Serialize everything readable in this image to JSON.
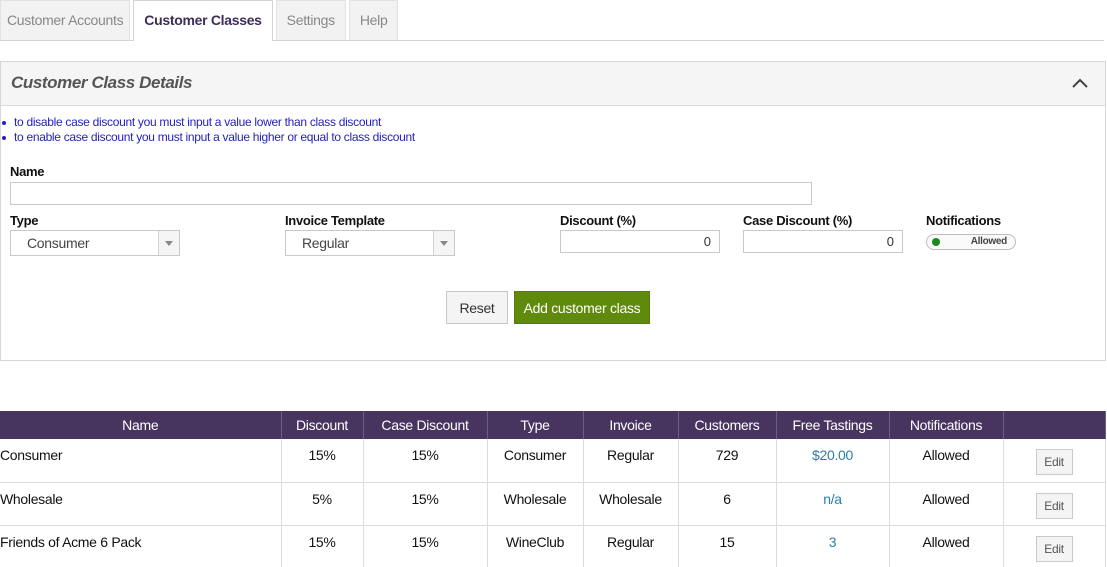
{
  "tabs": [
    {
      "label": "Customer Accounts",
      "active": false
    },
    {
      "label": "Customer Classes",
      "active": true
    },
    {
      "label": "Settings",
      "active": false
    },
    {
      "label": "Help",
      "active": false
    }
  ],
  "panel": {
    "title": "Customer Class Details",
    "collapse_icon": "chevron-up-icon",
    "notes": [
      "to disable case discount you must input a value lower than class discount",
      "to enable case discount you must input a value higher or equal to class discount"
    ],
    "note_color": "#2323b8"
  },
  "form": {
    "name_label": "Name",
    "name_value": "",
    "type_label": "Type",
    "type_value": "Consumer",
    "invoice_label": "Invoice Template",
    "invoice_value": "Regular",
    "discount_label": "Discount (%)",
    "discount_value": "0",
    "case_discount_label": "Case Discount (%)",
    "case_discount_value": "0",
    "notifications_label": "Notifications",
    "notifications_value": "Allowed",
    "toggle_color": "#1a8a1a",
    "reset_label": "Reset",
    "add_label": "Add customer class",
    "add_color": "#5f8a0c"
  },
  "table": {
    "header_color": "#47345f",
    "link_color": "#2a7fa6",
    "columns": [
      "Name",
      "Discount",
      "Case Discount",
      "Type",
      "Invoice",
      "Customers",
      "Free Tastings",
      "Notifications",
      ""
    ],
    "rows": [
      {
        "name": "Consumer",
        "discount": "15%",
        "case_discount": "15%",
        "type": "Consumer",
        "invoice": "Regular",
        "customers": "729",
        "free_tastings": "$20.00",
        "notifications": "Allowed",
        "action": "Edit"
      },
      {
        "name": "Wholesale",
        "discount": "5%",
        "case_discount": "15%",
        "type": "Wholesale",
        "invoice": "Wholesale",
        "customers": "6",
        "free_tastings": "n/a",
        "notifications": "Allowed",
        "action": "Edit"
      },
      {
        "name": "Friends of Acme 6 Pack",
        "discount": "15%",
        "case_discount": "15%",
        "type": "WineClub",
        "invoice": "Regular",
        "customers": "15",
        "free_tastings": "3",
        "notifications": "Allowed",
        "action": "Edit"
      }
    ]
  }
}
